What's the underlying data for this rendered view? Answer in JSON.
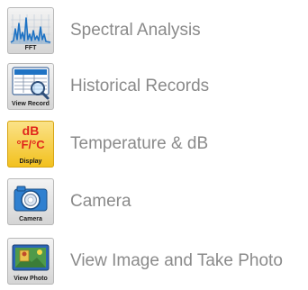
{
  "menu": {
    "items": [
      {
        "icon": "fft-spectrum-icon",
        "icon_caption": "FFT",
        "label": "Spectral Analysis"
      },
      {
        "icon": "view-record-icon",
        "icon_caption": "View Record",
        "label": "Historical Records"
      },
      {
        "icon": "temperature-db-display-icon",
        "icon_text_top": "dB",
        "icon_text_mid": "°F/°C",
        "icon_caption": "Display",
        "label": "Temperature & dB"
      },
      {
        "icon": "camera-icon",
        "icon_caption": "Camera",
        "label": "Camera"
      },
      {
        "icon": "view-photo-icon",
        "icon_caption": "View Photo",
        "label": "View Image and Take Photo"
      }
    ]
  },
  "colors": {
    "label_text": "#8a8a8a",
    "temp_tile": "#f2c01c",
    "temp_text": "#e0251b",
    "accent_blue": "#1f73c4"
  }
}
